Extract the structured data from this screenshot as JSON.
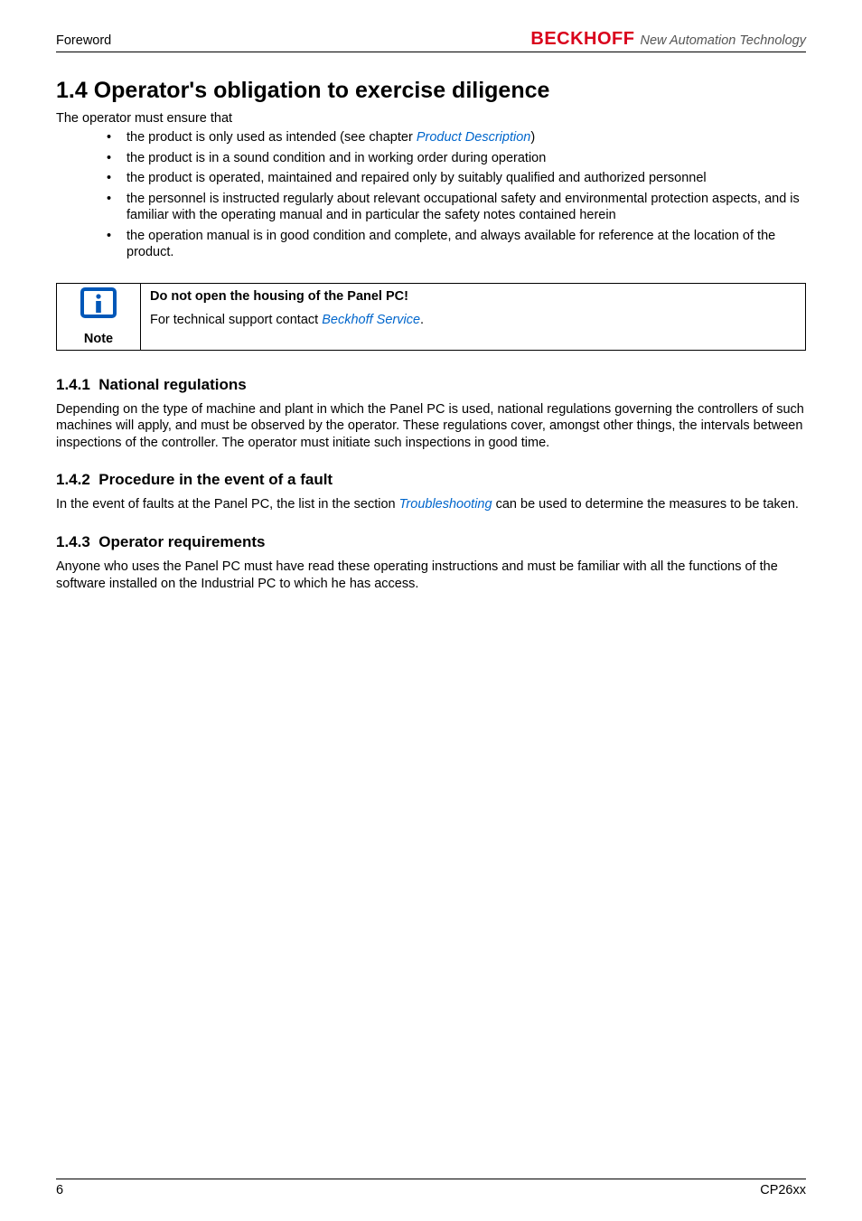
{
  "header": {
    "left": "Foreword",
    "brand": "BECKHOFF",
    "tagline": "New Automation Technology"
  },
  "section": {
    "number": "1.4",
    "title": "Operator's obligation to exercise diligence",
    "intro": "The operator must ensure that",
    "bullets": [
      {
        "pre": "the product is only used as intended (see chapter ",
        "link": "Product Description",
        "post": ")"
      },
      {
        "pre": "the product is in a sound condition and in working order during operation",
        "link": "",
        "post": ""
      },
      {
        "pre": "the product is operated, maintained and repaired only by suitably qualified and authorized personnel",
        "link": "",
        "post": ""
      },
      {
        "pre": "the personnel is instructed regularly about relevant occupational safety and environmental protection aspects, and is familiar with the operating manual and in particular the safety notes contained herein",
        "link": "",
        "post": ""
      },
      {
        "pre": "the operation manual is in good condition and complete, and always available for reference at the location of the product.",
        "link": "",
        "post": ""
      }
    ]
  },
  "note": {
    "label": "Note",
    "title": "Do not open the housing of the Panel PC!",
    "body_pre": "For technical support contact ",
    "body_link": "Beckhoff Service",
    "body_post": "."
  },
  "subsections": [
    {
      "number": "1.4.1",
      "title": "National regulations",
      "body_pre": "Depending on the type of machine and plant in which the Panel PC is used, national regulations governing the controllers of such machines will apply, and must be observed by the operator. These regulations cover, amongst other things, the intervals between inspections of the controller. The operator must initiate such inspections in good time.",
      "body_link": "",
      "body_post": ""
    },
    {
      "number": "1.4.2",
      "title": "Procedure in the event of a fault",
      "body_pre": "In the event of faults at the Panel PC, the list in the section ",
      "body_link": "Troubleshooting",
      "body_post": " can be used to determine the measures to be taken."
    },
    {
      "number": "1.4.3",
      "title": "Operator requirements",
      "body_pre": "Anyone who uses the Panel PC must have read these operating instructions and must be familiar with all the functions of the software installed on the Industrial PC to which he has access.",
      "body_link": "",
      "body_post": ""
    }
  ],
  "footer": {
    "left": "6",
    "right": "CP26xx"
  }
}
